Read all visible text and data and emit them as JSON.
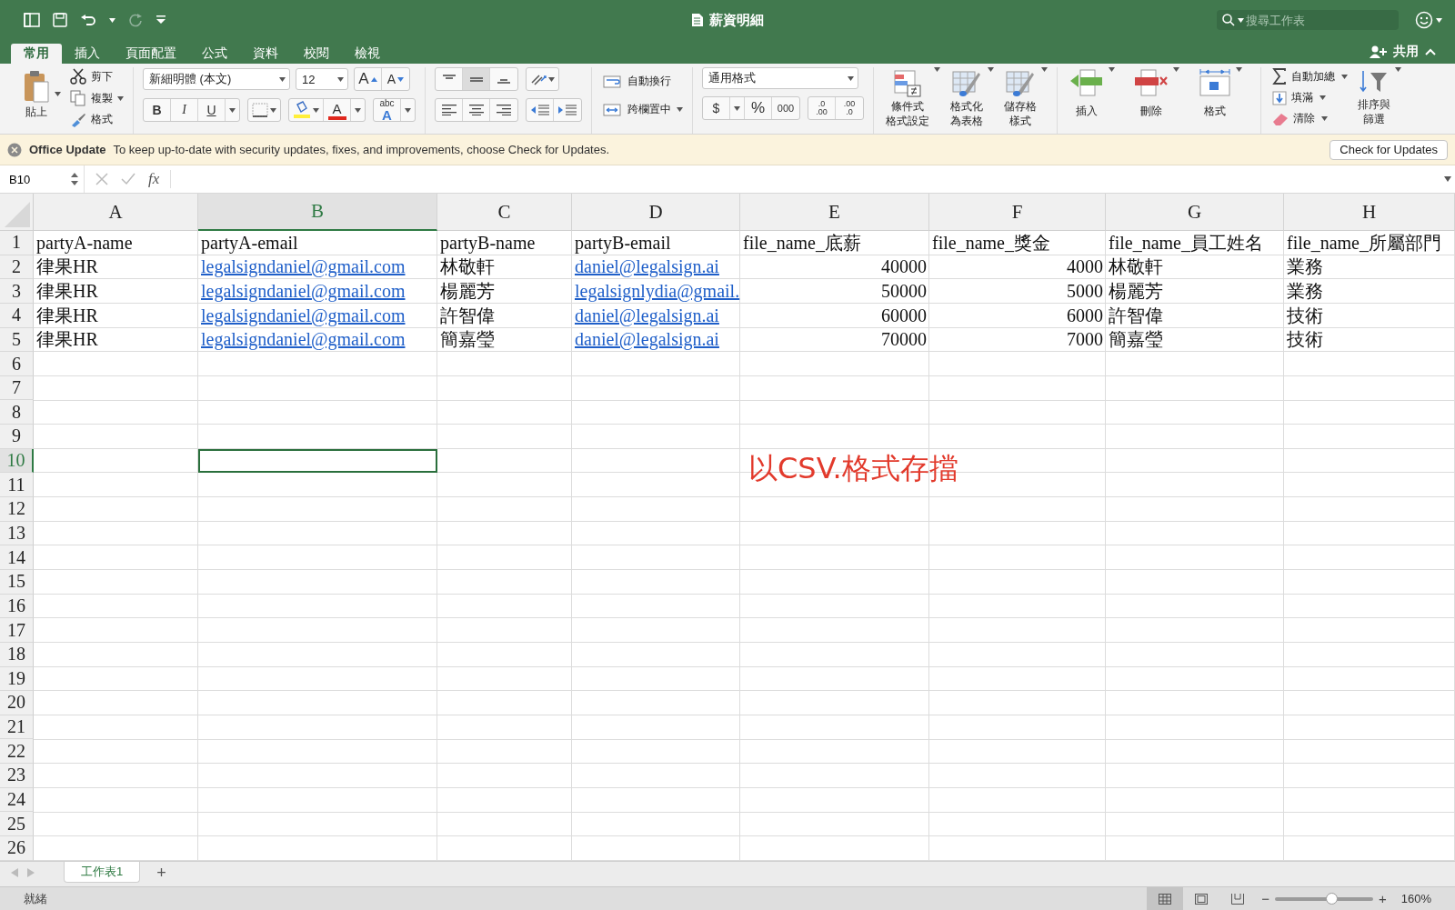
{
  "window": {
    "title": "薪資明細"
  },
  "search": {
    "placeholder": "搜尋工作表"
  },
  "share": "共用",
  "ribbon_tabs": [
    {
      "label": "常用",
      "selected": true
    },
    {
      "label": "插入",
      "selected": false
    },
    {
      "label": "頁面配置",
      "selected": false
    },
    {
      "label": "公式",
      "selected": false
    },
    {
      "label": "資料",
      "selected": false
    },
    {
      "label": "校閱",
      "selected": false
    },
    {
      "label": "檢視",
      "selected": false
    }
  ],
  "clipboard": {
    "paste": "貼上",
    "cut": "剪下",
    "copy": "複製",
    "format": "格式"
  },
  "font": {
    "name": "新細明體 (本文)",
    "size": "12",
    "grow": "A",
    "shrink": "A",
    "bold": "B",
    "italic": "I",
    "underline": "U",
    "color_button": "A",
    "phonetic_top": "abc",
    "phonetic_bottom": "A"
  },
  "alignment": {
    "wrap": "自動換行",
    "merge": "跨欄置中"
  },
  "number": {
    "format": "通用格式",
    "currency": "$",
    "percent": "%",
    "comma": "000",
    "increase_decimal": [
      ".0",
      ".00"
    ],
    "decrease_decimal": [
      ".00",
      ".0"
    ]
  },
  "styles": [
    [
      "條件式",
      "格式設定"
    ],
    [
      "格式化",
      "為表格"
    ],
    [
      "儲存格",
      "樣式"
    ]
  ],
  "cells_group": [
    "插入",
    "刪除",
    "格式"
  ],
  "editing": {
    "autosum": "自動加總",
    "fill": "填滿",
    "clear": "清除",
    "sort": [
      "排序與",
      "篩選"
    ]
  },
  "update_bar": {
    "title": "Office Update",
    "message": "To keep up-to-date with security updates, fixes, and improvements, choose Check for Updates.",
    "button": "Check for Updates"
  },
  "formula_bar": {
    "name_box": "B10",
    "fx": "fx"
  },
  "columns": [
    {
      "label": "A",
      "selected": false
    },
    {
      "label": "B",
      "selected": true
    },
    {
      "label": "C",
      "selected": false
    },
    {
      "label": "D",
      "selected": false
    },
    {
      "label": "E",
      "selected": false
    },
    {
      "label": "F",
      "selected": false
    },
    {
      "label": "G",
      "selected": false
    },
    {
      "label": "H",
      "selected": false
    }
  ],
  "rows": [
    {
      "label": "1",
      "selected": false
    },
    {
      "label": "2",
      "selected": false
    },
    {
      "label": "3",
      "selected": false
    },
    {
      "label": "4",
      "selected": false
    },
    {
      "label": "5",
      "selected": false
    },
    {
      "label": "6",
      "selected": false
    },
    {
      "label": "7",
      "selected": false
    },
    {
      "label": "8",
      "selected": false
    },
    {
      "label": "9",
      "selected": false
    },
    {
      "label": "10",
      "selected": true
    },
    {
      "label": "11",
      "selected": false
    },
    {
      "label": "12",
      "selected": false
    },
    {
      "label": "13",
      "selected": false
    },
    {
      "label": "14",
      "selected": false
    },
    {
      "label": "15",
      "selected": false
    },
    {
      "label": "16",
      "selected": false
    },
    {
      "label": "17",
      "selected": false
    },
    {
      "label": "18",
      "selected": false
    },
    {
      "label": "19",
      "selected": false
    },
    {
      "label": "20",
      "selected": false
    },
    {
      "label": "21",
      "selected": false
    },
    {
      "label": "22",
      "selected": false
    },
    {
      "label": "23",
      "selected": false
    },
    {
      "label": "24",
      "selected": false
    },
    {
      "label": "25",
      "selected": false
    },
    {
      "label": "26",
      "selected": false
    }
  ],
  "cells": [
    [
      {
        "kind": "text",
        "text": "partyA-name"
      },
      {
        "kind": "text",
        "text": "partyA-email"
      },
      {
        "kind": "text",
        "text": "partyB-name"
      },
      {
        "kind": "text",
        "text": "partyB-email"
      },
      {
        "kind": "text",
        "text": "file_name_底薪"
      },
      {
        "kind": "text",
        "text": "file_name_獎金"
      },
      {
        "kind": "text",
        "text": "file_name_員工姓名"
      },
      {
        "kind": "text",
        "text": "file_name_所屬部門"
      }
    ],
    [
      {
        "kind": "text",
        "text": "律果HR"
      },
      {
        "kind": "link",
        "text": "legalsigndaniel@gmail.com"
      },
      {
        "kind": "text",
        "text": "林敬軒"
      },
      {
        "kind": "link",
        "text": "daniel@legalsign.ai"
      },
      {
        "kind": "number",
        "text": "40000"
      },
      {
        "kind": "number",
        "text": "4000"
      },
      {
        "kind": "text",
        "text": "林敬軒"
      },
      {
        "kind": "text",
        "text": "業務"
      }
    ],
    [
      {
        "kind": "text",
        "text": "律果HR"
      },
      {
        "kind": "link",
        "text": "legalsigndaniel@gmail.com"
      },
      {
        "kind": "text",
        "text": "楊麗芳"
      },
      {
        "kind": "link",
        "text": "legalsignlydia@gmail."
      },
      {
        "kind": "number",
        "text": "50000"
      },
      {
        "kind": "number",
        "text": "5000"
      },
      {
        "kind": "text",
        "text": "楊麗芳"
      },
      {
        "kind": "text",
        "text": "業務"
      }
    ],
    [
      {
        "kind": "text",
        "text": "律果HR"
      },
      {
        "kind": "link",
        "text": "legalsigndaniel@gmail.com"
      },
      {
        "kind": "text",
        "text": "許智偉"
      },
      {
        "kind": "link",
        "text": "daniel@legalsign.ai"
      },
      {
        "kind": "number",
        "text": "60000"
      },
      {
        "kind": "number",
        "text": "6000"
      },
      {
        "kind": "text",
        "text": "許智偉"
      },
      {
        "kind": "text",
        "text": "技術"
      }
    ],
    [
      {
        "kind": "text",
        "text": "律果HR"
      },
      {
        "kind": "link",
        "text": "legalsigndaniel@gmail.com"
      },
      {
        "kind": "text",
        "text": "簡嘉瑩"
      },
      {
        "kind": "link",
        "text": "daniel@legalsign.ai"
      },
      {
        "kind": "number",
        "text": "70000"
      },
      {
        "kind": "number",
        "text": "7000"
      },
      {
        "kind": "text",
        "text": "簡嘉瑩"
      },
      {
        "kind": "text",
        "text": "技術"
      }
    ]
  ],
  "text_box": "以CSV.格式存擋",
  "sheet_tabs": [
    {
      "label": "工作表1",
      "selected": true
    }
  ],
  "add_sheet": "+",
  "status_bar": {
    "status": "就緒",
    "views": [
      {
        "kind": "normal",
        "selected": true
      },
      {
        "kind": "layout",
        "selected": false
      },
      {
        "kind": "pagebreak",
        "selected": false
      }
    ],
    "zoom": {
      "level": 0.57
    },
    "zoom_minus": "−",
    "zoom_plus": "+",
    "zoom_text": "160%"
  }
}
